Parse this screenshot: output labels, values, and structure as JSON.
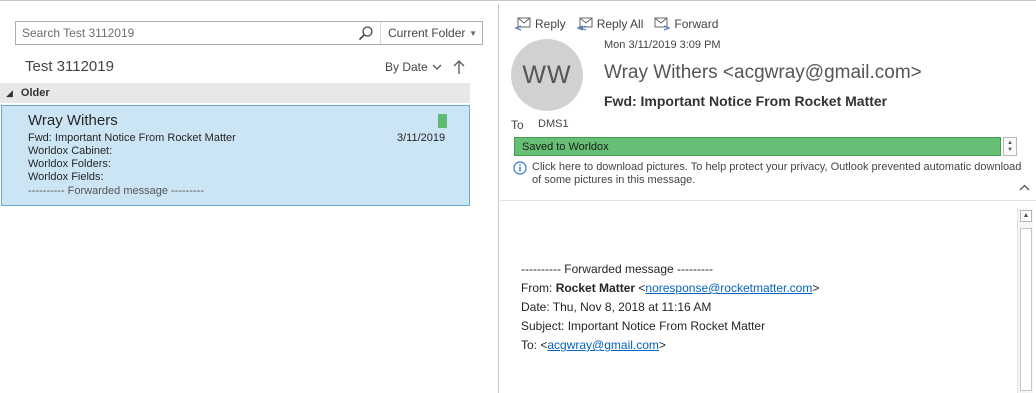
{
  "search": {
    "placeholder": "Search Test 3112019",
    "scope": "Current Folder"
  },
  "list": {
    "folder_title": "Test 3112019",
    "sort_label": "By Date",
    "group_label": "Older",
    "item": {
      "sender": "Wray Withers",
      "subject": "Fwd: Important Notice From Rocket Matter",
      "date": "3/11/2019",
      "preview_lines": [
        "Worldox Cabinet:",
        "Worldox Folders:",
        "Worldox Fields:",
        "---------- Forwarded message ---------"
      ],
      "category_color": "#5db974"
    }
  },
  "reading": {
    "actions": {
      "reply": "Reply",
      "reply_all": "Reply All",
      "forward": "Forward"
    },
    "avatar_initials": "WW",
    "sent_date": "Mon 3/11/2019 3:09 PM",
    "from": "Wray Withers <acgwray@gmail.com>",
    "subject": "Fwd: Important Notice From Rocket Matter",
    "to_label": "To",
    "to_value": "DMS1",
    "category": {
      "label": "Saved to Worldox",
      "color": "#66bf74"
    },
    "info": "Click here to download pictures. To help protect your privacy, Outlook prevented automatic download of some pictures in this message.",
    "body": {
      "forwarded_header": "---------- Forwarded message ---------",
      "from_label": "From:",
      "from_name": "Rocket Matter",
      "from_open": "<",
      "from_email": "noresponse@rocketmatter.com",
      "from_close": ">",
      "date": "Date: Thu, Nov 8, 2018 at 11:16 AM",
      "subject": "Subject: Important Notice From Rocket Matter",
      "to_label": "To:",
      "to_open": "<",
      "to_email": "acgwray@gmail.com",
      "to_close": ">"
    }
  },
  "colors": {
    "selection": "#cce5f5",
    "link": "#0563c1",
    "accent": "#0072c6"
  }
}
